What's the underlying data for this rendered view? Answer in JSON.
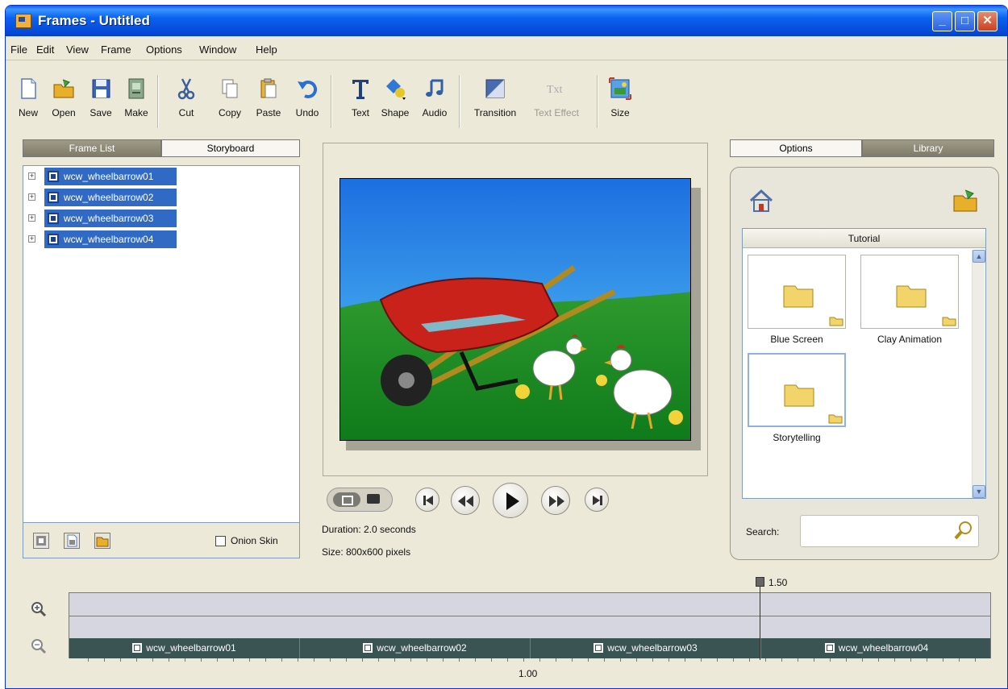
{
  "window": {
    "title": "Frames - Untitled",
    "controls": {
      "minimize": "_",
      "maximize": "□",
      "close": "✕"
    }
  },
  "menu": [
    "File",
    "Edit",
    "View",
    "Frame",
    "Options",
    "Window",
    "Help"
  ],
  "toolbar": {
    "new": "New",
    "open": "Open",
    "save": "Save",
    "make": "Make",
    "cut": "Cut",
    "copy": "Copy",
    "paste": "Paste",
    "undo": "Undo",
    "text": "Text",
    "shape": "Shape",
    "audio": "Audio",
    "transition": "Transition",
    "text_effect": "Text Effect",
    "size": "Size"
  },
  "left_tabs": {
    "frame_list": "Frame List",
    "storyboard": "Storyboard",
    "active": "storyboard"
  },
  "frames": [
    "wcw_wheelbarrow01",
    "wcw_wheelbarrow02",
    "wcw_wheelbarrow03",
    "wcw_wheelbarrow04"
  ],
  "left_bottom": {
    "onion_skin_label": "Onion Skin",
    "onion_skin_checked": false
  },
  "preview": {
    "duration": "Duration: 2.0 seconds",
    "size": "Size: 800x600 pixels"
  },
  "right_tabs": {
    "options": "Options",
    "library": "Library",
    "active": "options"
  },
  "library": {
    "header": "Tutorial",
    "items": [
      {
        "label": "Blue Screen",
        "selected": false
      },
      {
        "label": "Clay Animation",
        "selected": false
      },
      {
        "label": "Storytelling",
        "selected": true
      }
    ]
  },
  "search": {
    "label": "Search:",
    "value": ""
  },
  "timeline": {
    "frames": [
      "wcw_wheelbarrow01",
      "wcw_wheelbarrow02",
      "wcw_wheelbarrow03",
      "wcw_wheelbarrow04"
    ],
    "playhead_label": "1.50",
    "ruler_label": "1.00"
  },
  "colors": {
    "selection": "#316ac5",
    "title_bar": "#0a5fe8",
    "timeline_frames": "#3a5353"
  }
}
